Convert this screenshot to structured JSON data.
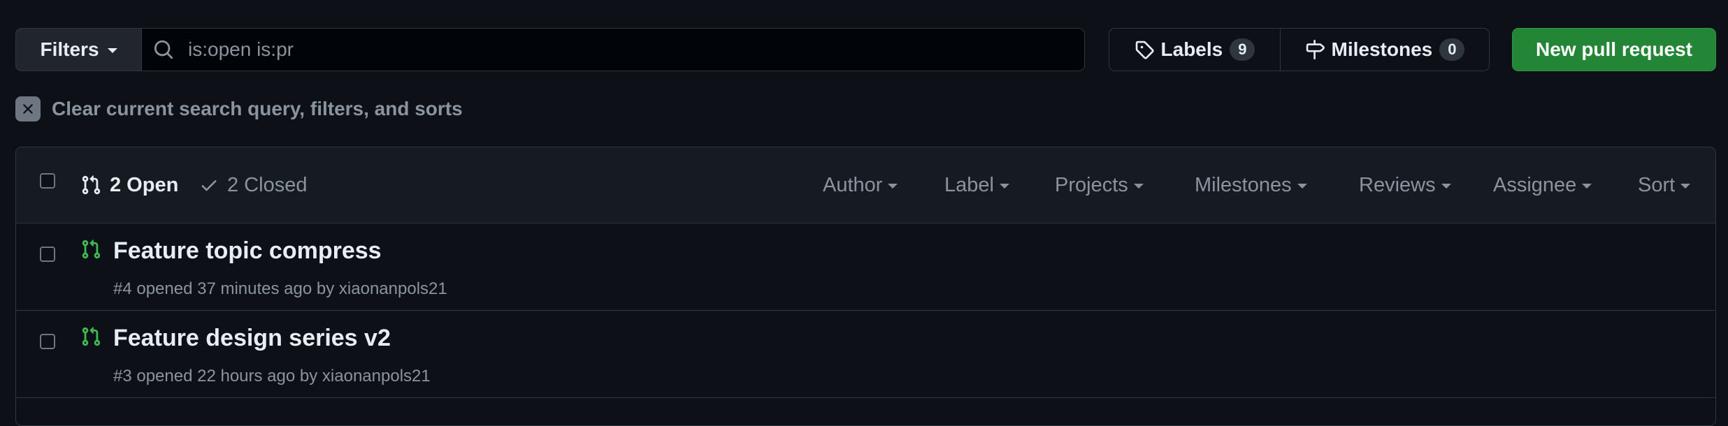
{
  "toolbar": {
    "filters_label": "Filters",
    "search_value": "is:open is:pr",
    "labels_label": "Labels",
    "labels_count": "9",
    "milestones_label": "Milestones",
    "milestones_count": "0",
    "new_pr_label": "New pull request"
  },
  "clear": {
    "text": "Clear current search query, filters, and sorts"
  },
  "list_header": {
    "open_label": "2 Open",
    "closed_label": "2 Closed",
    "filters": [
      "Author",
      "Label",
      "Projects",
      "Milestones",
      "Reviews",
      "Assignee",
      "Sort"
    ]
  },
  "pull_requests": [
    {
      "title": "Feature topic compress",
      "meta_prefix": "#4 opened 37 minutes ago by ",
      "author": "xiaonanpols21"
    },
    {
      "title": "Feature design series v2",
      "meta_prefix": "#3 opened 22 hours ago by ",
      "author": "xiaonanpols21"
    }
  ],
  "colors": {
    "background": "#0d1117",
    "header_bg": "#161b22",
    "border": "#30363d",
    "primary_button": "#238636",
    "open_pr_icon": "#3fb950",
    "muted_text": "#8b949e"
  }
}
